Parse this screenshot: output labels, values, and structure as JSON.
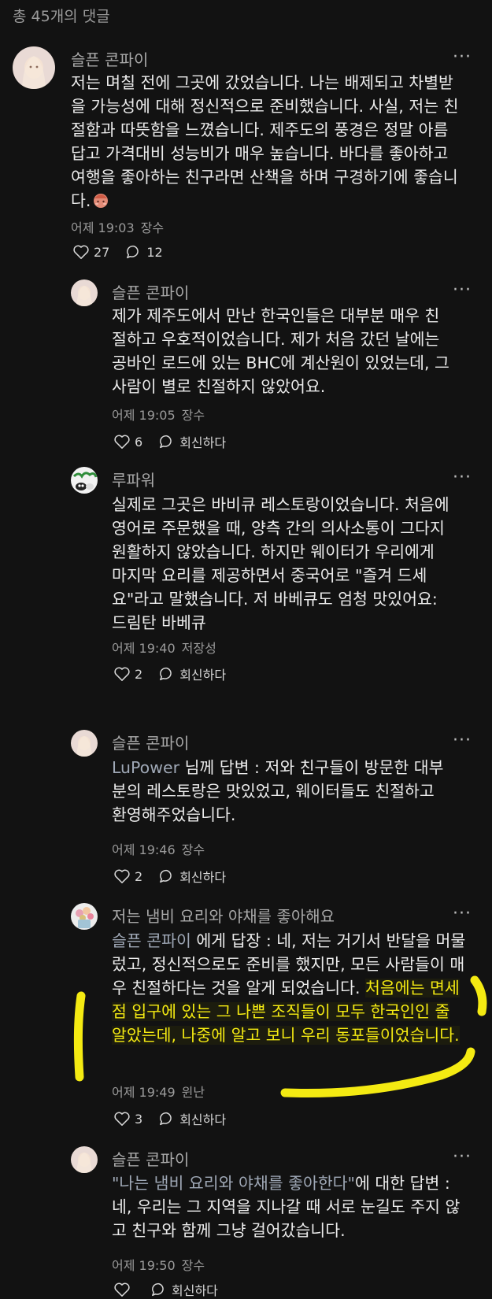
{
  "header": {
    "count": "총 45개의 댓글"
  },
  "comments": [
    {
      "author": "슬픈 콘파이",
      "text": "저는 며칠 전에 그곳에 갔었습니다. 나는 배제되고 차별받을 가능성에 대해 정신적으로 준비했습니다. 사실, 저는 친절함과 따뜻함을 느꼈습니다. 제주도의 풍경은 정말 아름답고 가격대비 성능비가 매우 높습니다. 바다를 좋아하고 여행을 좋아하는 친구라면 산책을 하며 구경하기에 좋습니다.",
      "time": "어제 19:03",
      "location": "장수",
      "likes": "27",
      "replies": "12"
    },
    {
      "author": "슬픈 콘파이",
      "text": "제가 제주도에서 만난 한국인들은 대부분 매우 친절하고 우호적이었습니다. 제가 처음 갔던 날에는 공바인 로드에 있는 BHC에 계산원이 있었는데, 그 사람이 별로 친절하지 않았어요.",
      "time": "어제 19:05",
      "location": "장수",
      "likes": "6",
      "reply_label": "회신하다"
    },
    {
      "author": "루파워",
      "text": "실제로 그곳은 바비큐 레스토랑이었습니다. 처음에 영어로 주문했을 때, 양측 간의 의사소통이 그다지 원활하지 않았습니다. 하지만 웨이터가 우리에게 마지막 요리를 제공하면서 중국어로 \"즐겨 드세요\"라고 말했습니다. 저 바베큐도 엄청 맛있어요: 드림탄 바베큐",
      "time": "어제 19:40",
      "location": "저장성",
      "likes": "2",
      "reply_label": "회신하다"
    },
    {
      "author": "슬픈 콘파이",
      "mention": "LuPower",
      "text": " 님께 답변 : 저와 친구들이 방문한 대부분의 레스토랑은 맛있었고, 웨이터들도 친절하고 환영해주었습니다.",
      "time": "어제 19:46",
      "location": "장수",
      "likes": "2",
      "reply_label": "회신하다"
    },
    {
      "author": "저는 냄비 요리와 야채를 좋아해요",
      "mention": "슬픈 콘파이",
      "text": " 에게 답장 : 네, 저는 거기서 반달을 머물렀고, 정신적으로도 준비를 했지만, 모든 사람들이 매우 친절하다는 것을 알게 되었습니다. ",
      "highlight": "처음에는 면세점 입구에 있는 그 나쁜 조직들이 모두 한국인인 줄 알았는데, 나중에 알고 보니 우리 동포들이었습니다.",
      "time": "어제 19:49",
      "location": "윈난",
      "likes": "3",
      "reply_label": "회신하다"
    },
    {
      "author": "슬픈 콘파이",
      "mention": "\"나는 냄비 요리와 야채를 좋아한다\"",
      "text": "에 대한 답변 : 네, 우리는 그 지역을 지나갈 때 서로 눈길도 주지 않고 친구와 함께 그냥 걸어갔습니다.",
      "time": "어제 19:50",
      "location": "장수",
      "likes": "",
      "reply_label": "회신하다"
    }
  ],
  "more_label": "···",
  "colors": {
    "background": "#121212",
    "highlight": "#f4ea12",
    "mention": "#9fa8b6"
  },
  "icons": {
    "like": "heart-outline-icon",
    "reply": "speech-bubble-icon",
    "emoji": "blushing-face-emoji",
    "more": "more-dots-icon"
  }
}
